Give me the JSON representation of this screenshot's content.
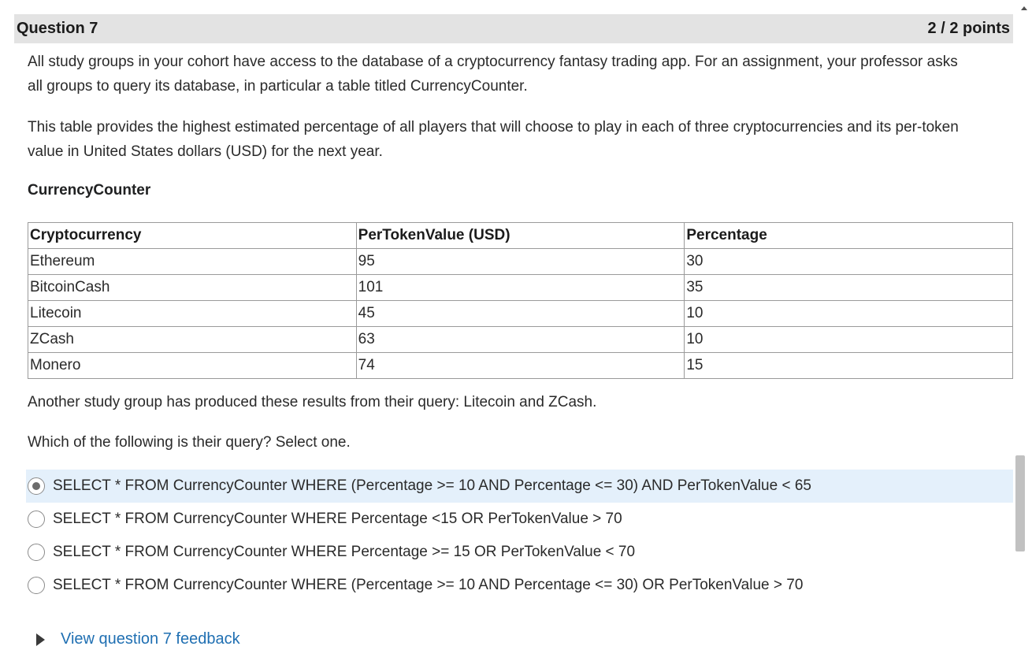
{
  "header": {
    "title": "Question 7",
    "score": "2 / 2 points"
  },
  "body": {
    "paragraph1": "All study groups in your cohort have access to the database of a cryptocurrency fantasy trading app. For an assignment, your professor asks all groups to query its database, in particular a table titled CurrencyCounter.",
    "paragraph2": "This table provides the highest estimated percentage of all players that will choose to play in each of three cryptocurrencies and its per-token value in United States dollars (USD) for the next year.",
    "table_title": "CurrencyCounter",
    "table": {
      "headers": [
        "Cryptocurrency",
        "PerTokenValue (USD)",
        "Percentage"
      ],
      "rows": [
        [
          "Ethereum",
          "95",
          "30"
        ],
        [
          "BitcoinCash",
          "101",
          "35"
        ],
        [
          "Litecoin",
          "45",
          "10"
        ],
        [
          "ZCash",
          "63",
          "10"
        ],
        [
          "Monero",
          "74",
          "15"
        ]
      ]
    },
    "paragraph3": "Another study group has produced these results from their query: Litecoin and ZCash.",
    "paragraph4": "Which of the following is their query? Select one."
  },
  "options": [
    {
      "label": "SELECT * FROM CurrencyCounter WHERE (Percentage >= 10 AND Percentage <= 30) AND PerTokenValue < 65",
      "selected": true
    },
    {
      "label": "SELECT * FROM CurrencyCounter WHERE Percentage <15 OR PerTokenValue > 70",
      "selected": false
    },
    {
      "label": "SELECT * FROM CurrencyCounter WHERE Percentage >= 15 OR PerTokenValue < 70",
      "selected": false
    },
    {
      "label": "SELECT * FROM CurrencyCounter WHERE (Percentage >= 10 AND Percentage <= 30) OR PerTokenValue > 70",
      "selected": false
    }
  ],
  "feedback_link": "View question 7 feedback",
  "icons": {
    "expand": "triangle-right-icon",
    "scroll_up": "scroll-up-arrow-icon"
  },
  "colors": {
    "header_bg": "#e3e3e3",
    "selected_bg": "#e4f0fb",
    "link": "#1f6fb2"
  }
}
